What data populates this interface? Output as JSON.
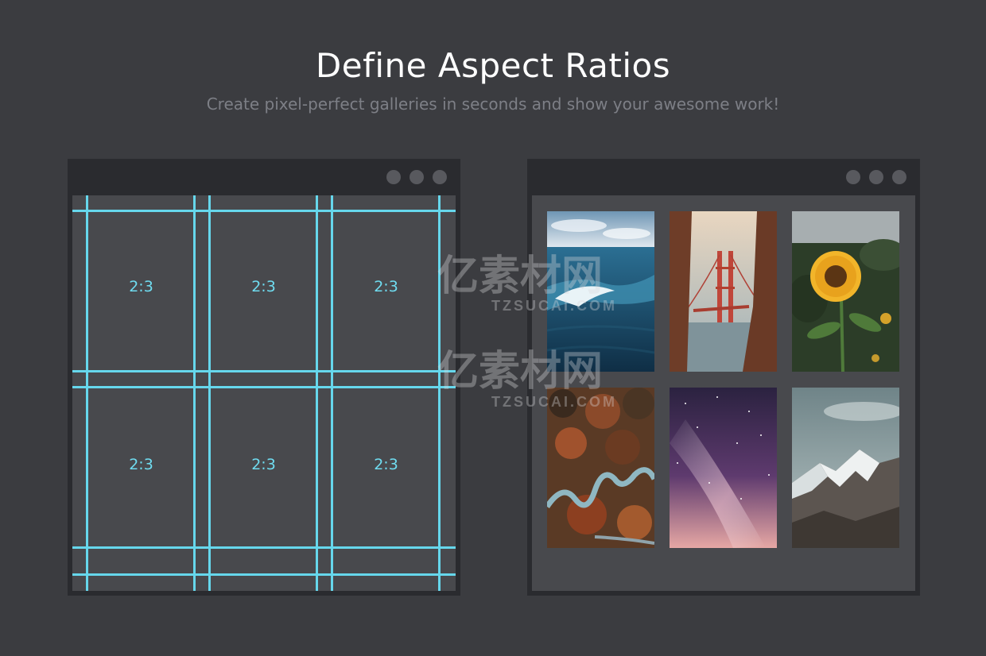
{
  "header": {
    "title": "Define Aspect Ratios",
    "subtitle": "Create pixel-perfect galleries in seconds and show your awesome work!"
  },
  "grid_window": {
    "cells": [
      {
        "label": "2:3"
      },
      {
        "label": "2:3"
      },
      {
        "label": "2:3"
      },
      {
        "label": "2:3"
      },
      {
        "label": "2:3"
      },
      {
        "label": "2:3"
      }
    ]
  },
  "gallery_window": {
    "photos": [
      {
        "icon": "ocean-wave-photo"
      },
      {
        "icon": "golden-gate-bridge-photo"
      },
      {
        "icon": "sunflower-photo"
      },
      {
        "icon": "winding-river-forest-photo"
      },
      {
        "icon": "milky-way-night-sky-photo"
      },
      {
        "icon": "snowy-mountain-photo"
      }
    ]
  },
  "colors": {
    "background": "#3b3c40",
    "window_frame": "#2a2b2f",
    "window_content": "#48494d",
    "guide_lines": "#66d7ec",
    "title_text": "#ffffff",
    "subtitle_text": "#7d7f86"
  },
  "watermark": {
    "text_cn": "亿素材网",
    "text_en": "TZSUCAI.COM"
  }
}
